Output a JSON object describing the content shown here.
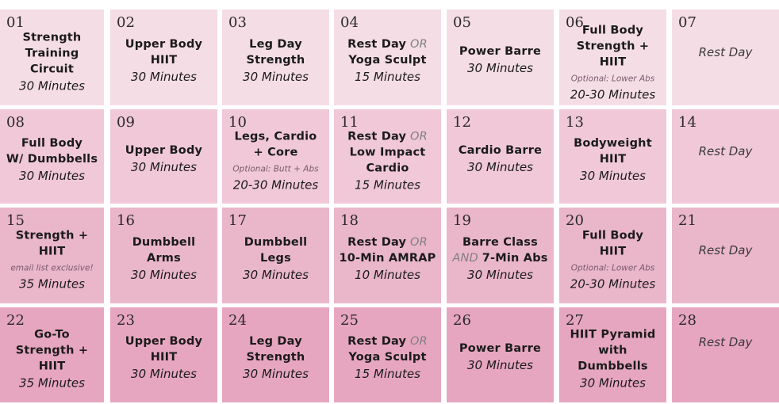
{
  "row_colors": [
    "#f5dde6",
    "#f0c8d8",
    "#eab6ca",
    "#e7a6bf"
  ],
  "days": [
    {
      "num": "01",
      "title": [
        "Strength",
        "Training",
        "Circuit"
      ],
      "duration": "30 Minutes"
    },
    {
      "num": "02",
      "title": [
        "Upper Body",
        "HIIT"
      ],
      "duration": "30 Minutes"
    },
    {
      "num": "03",
      "title": [
        "Leg Day",
        "Strength"
      ],
      "duration": "30 Minutes"
    },
    {
      "num": "04",
      "title": [
        "Rest Day",
        "Yoga Sculpt"
      ],
      "or_word": "OR",
      "duration": "15 Minutes"
    },
    {
      "num": "05",
      "title": [
        "Power Barre"
      ],
      "duration": "30 Minutes"
    },
    {
      "num": "06",
      "title": [
        "Full Body",
        "Strength + HIIT"
      ],
      "note": "Optional: Lower Abs",
      "duration": "20-30 Minutes"
    },
    {
      "num": "07",
      "rest": "Rest Day"
    },
    {
      "num": "08",
      "title": [
        "Full Body",
        "W/ Dumbbells"
      ],
      "duration": "30 Minutes"
    },
    {
      "num": "09",
      "title": [
        "Upper Body"
      ],
      "duration": "30 Minutes"
    },
    {
      "num": "10",
      "title": [
        "Legs, Cardio",
        "+ Core"
      ],
      "note": "Optional: Butt + Abs",
      "duration": "20-30 Minutes"
    },
    {
      "num": "11",
      "title": [
        "Rest Day",
        "Low Impact",
        "Cardio"
      ],
      "or_word": "OR",
      "duration": "15 Minutes"
    },
    {
      "num": "12",
      "title": [
        "Cardio Barre"
      ],
      "duration": "30 Minutes"
    },
    {
      "num": "13",
      "title": [
        "Bodyweight",
        "HIIT"
      ],
      "duration": "30 Minutes"
    },
    {
      "num": "14",
      "rest": "Rest Day"
    },
    {
      "num": "15",
      "title": [
        "Strength + HIIT"
      ],
      "note": "email list exclusive!",
      "duration": "35 Minutes"
    },
    {
      "num": "16",
      "title": [
        "Dumbbell",
        "Arms"
      ],
      "duration": "30 Minutes"
    },
    {
      "num": "17",
      "title": [
        "Dumbbell",
        "Legs"
      ],
      "duration": "30 Minutes"
    },
    {
      "num": "18",
      "title": [
        "Rest Day",
        "10-Min AMRAP"
      ],
      "or_word": "OR",
      "duration": "10 Minutes"
    },
    {
      "num": "19",
      "title": [
        "Barre Class",
        "7-Min Abs"
      ],
      "and_word": "AND",
      "duration": "30 Minutes"
    },
    {
      "num": "20",
      "title": [
        "Full Body",
        "HIIT"
      ],
      "note": "Optional: Lower Abs",
      "duration": "20-30 Minutes"
    },
    {
      "num": "21",
      "rest": "Rest Day"
    },
    {
      "num": "22",
      "title": [
        "Go-To",
        "Strength + HIIT"
      ],
      "duration": "35 Minutes"
    },
    {
      "num": "23",
      "title": [
        "Upper Body",
        "HIIT"
      ],
      "duration": "30 Minutes"
    },
    {
      "num": "24",
      "title": [
        "Leg Day",
        "Strength"
      ],
      "duration": "30 Minutes"
    },
    {
      "num": "25",
      "title": [
        "Rest Day",
        "Yoga Sculpt"
      ],
      "or_word": "OR",
      "duration": "15 Minutes"
    },
    {
      "num": "26",
      "title": [
        "Power Barre"
      ],
      "duration": "30 Minutes"
    },
    {
      "num": "27",
      "title": [
        "HIIT Pyramid",
        "with Dumbbells"
      ],
      "duration": "30 Minutes"
    },
    {
      "num": "28",
      "rest": "Rest Day"
    }
  ]
}
